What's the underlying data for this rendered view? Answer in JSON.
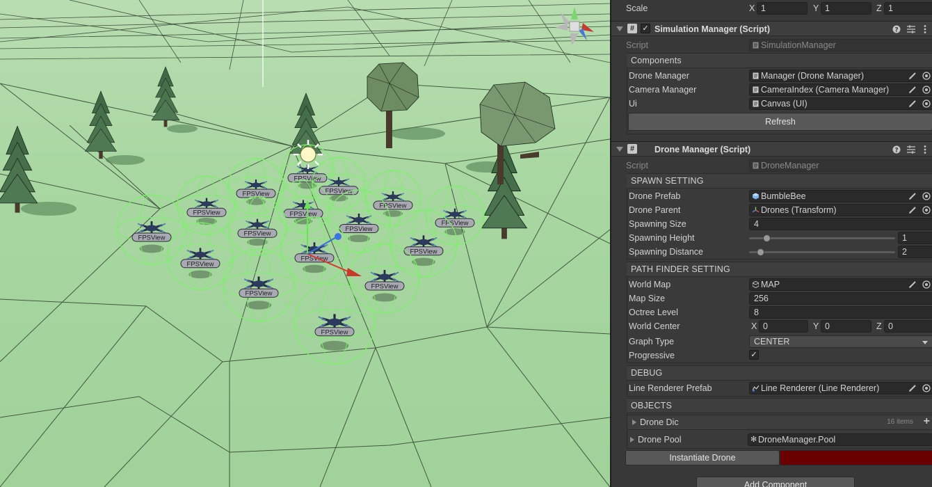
{
  "scene": {
    "fps_label": "FPSView"
  },
  "transform": {
    "scale_label": "Scale",
    "axes": [
      "X",
      "Y",
      "Z"
    ],
    "scale": [
      "1",
      "1",
      "1"
    ]
  },
  "simulation_manager": {
    "title": "Simulation Manager (Script)",
    "script_label": "Script",
    "script_value": "SimulationManager",
    "components_header": "Components",
    "fields": [
      {
        "label": "Drone Manager",
        "value": "Manager (Drone Manager)"
      },
      {
        "label": "Camera Manager",
        "value": "CameraIndex (Camera Manager)"
      },
      {
        "label": "Ui",
        "value": "Canvas (UI)"
      }
    ],
    "refresh_button": "Refresh"
  },
  "drone_manager": {
    "title": "Drone Manager (Script)",
    "script_label": "Script",
    "script_value": "DroneManager",
    "spawn_setting": {
      "header": "SPAWN SETTING",
      "drone_prefab_label": "Drone Prefab",
      "drone_prefab_value": "BumbleBee",
      "drone_parent_label": "Drone Parent",
      "drone_parent_value": "Drones (Transform)",
      "spawning_size_label": "Spawning Size",
      "spawning_size_value": "4",
      "spawning_height_label": "Spawning Height",
      "spawning_height_value": "1",
      "spawning_distance_label": "Spawning Distance",
      "spawning_distance_value": "2"
    },
    "path_finder": {
      "header": "PATH FINDER SETTING",
      "world_map_label": "World Map",
      "world_map_value": "MAP",
      "map_size_label": "Map Size",
      "map_size_value": "256",
      "octree_level_label": "Octree Level",
      "octree_level_value": "8",
      "world_center_label": "World Center",
      "world_center": [
        "0",
        "0",
        "0"
      ],
      "graph_type_label": "Graph Type",
      "graph_type_value": "CENTER",
      "progressive_label": "Progressive",
      "progressive_check": "✓"
    },
    "debug": {
      "header": "DEBUG",
      "line_renderer_label": "Line Renderer Prefab",
      "line_renderer_value": "Line Renderer (Line Renderer)"
    },
    "objects": {
      "header": "OBJECTS",
      "drone_dic_label": "Drone Dic",
      "drone_dic_count": "16 items",
      "drone_pool_label": "Drone Pool",
      "drone_pool_value": "DroneManager.Pool"
    },
    "instantiate_button": "Instantiate Drone",
    "enabled_check": "✓"
  },
  "add_component_button": "Add Component",
  "colors": {
    "ground": "#a3d49c",
    "wire": "#1d2a1d",
    "gizmo_green": "#7cf06a",
    "instantiate_bar": "#6b0000"
  }
}
